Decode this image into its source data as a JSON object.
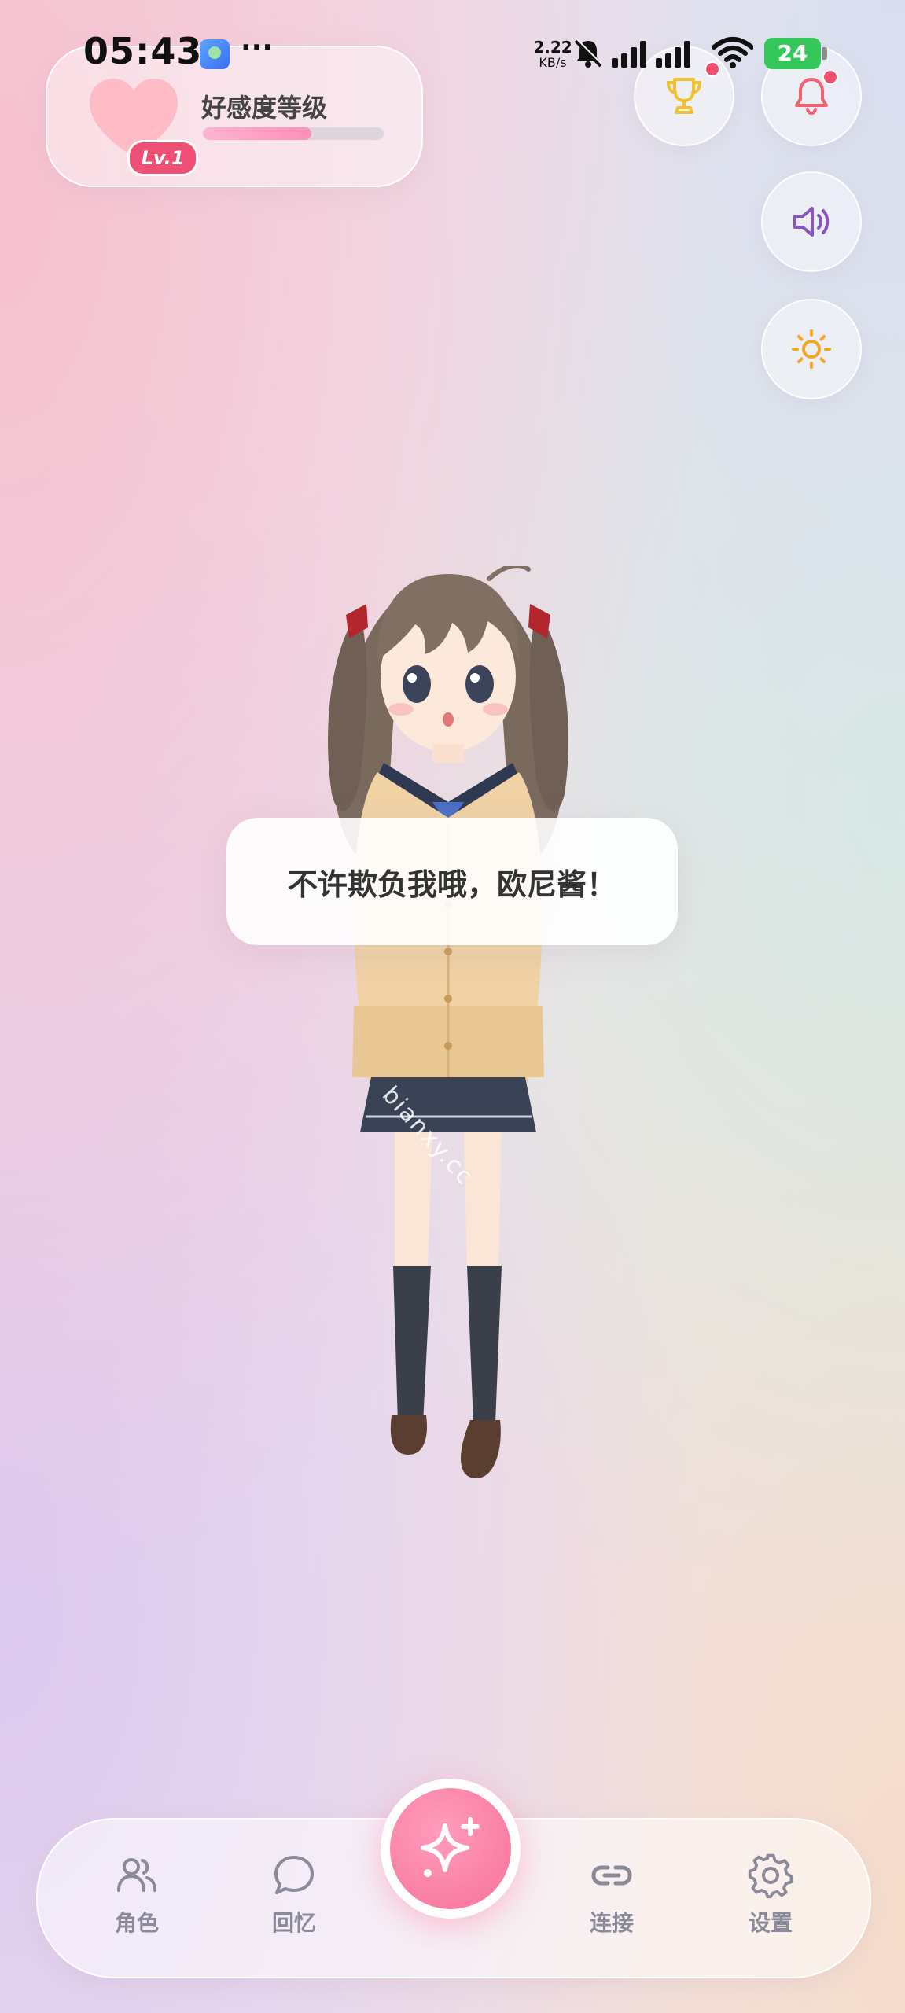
{
  "status_bar": {
    "time": "05:43",
    "more": "···",
    "net_speed_value": "2.22",
    "net_speed_unit": "KB/s",
    "battery": "24",
    "icons": [
      "app-icon",
      "mute-bell-icon",
      "signal-icon",
      "wifi-icon",
      "battery-icon"
    ]
  },
  "affection": {
    "title": "好感度等级",
    "level": "Lv.1",
    "progress": 0.6,
    "heart_color": "#ffb8c4",
    "badge_color": "#ef4f72"
  },
  "actions": [
    {
      "name": "trophy",
      "icon": "trophy-icon",
      "color": "#f0c230",
      "badge": true
    },
    {
      "name": "notifications",
      "icon": "bell-icon",
      "color": "#f06270",
      "badge": true
    },
    {
      "name": "sound",
      "icon": "speaker-icon",
      "color": "#8a55c0"
    },
    {
      "name": "brightness",
      "icon": "sun-icon",
      "color": "#f3a52a"
    }
  ],
  "speech": {
    "text": "不许欺负我哦，欧尼酱！"
  },
  "watermark": "bianxy.cc",
  "bottom_nav": {
    "items": [
      {
        "label": "角色",
        "icon": "users-icon"
      },
      {
        "label": "回忆",
        "icon": "chat-bubble-icon"
      },
      {
        "label": "连接",
        "icon": "link-icon"
      },
      {
        "label": "设置",
        "icon": "gear-icon"
      }
    ],
    "center_icon": "sparkle-icon",
    "center_color": "#f77299"
  }
}
